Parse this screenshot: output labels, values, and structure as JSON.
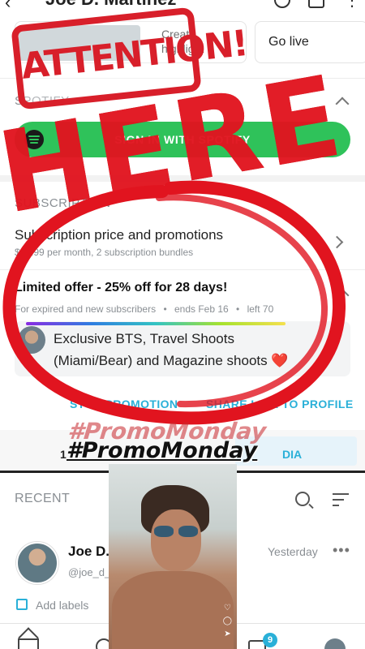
{
  "header": {
    "title": "Joe D. Martinez",
    "back_icon": "back-arrow-icon",
    "actions": [
      "gear-icon",
      "square-icon",
      "more-vertical-icon"
    ]
  },
  "tiles": {
    "create_highlight": "Create\nhighlight",
    "go_live": "Go live"
  },
  "spotify": {
    "section_label": "SPOTIFY",
    "button_label": "SIGN IN WITH SPOTIFY",
    "icon": "spotify-icon",
    "color": "#2fc25a"
  },
  "subscription": {
    "section_label": "SUBSCRIPTION",
    "price_title": "Subscription price and promotions",
    "price_meta": "$14.99 per month, 2 subscription bundles"
  },
  "offer": {
    "title": "Limited offer - 25% off for 28 days!",
    "audience": "For expired and new subscribers",
    "ends": "ends Feb 16",
    "left": "left 70",
    "message": "Exclusive BTS, Travel Shoots (Miami/Bear) and Magazine shoots",
    "heart": "❤️",
    "stop_label": "STOP PROMOTION",
    "share_label": "SHARE LINK TO PROFILE"
  },
  "tabs": {
    "left_label": "1",
    "right_label": "DIA"
  },
  "recent": {
    "label": "RECENT"
  },
  "chat": {
    "name": "Joe D.",
    "handle": "@joe_d_",
    "time": "Yesterday",
    "more": "•••",
    "add_labels": "Add labels"
  },
  "nav": {
    "badge": "9",
    "accent": "#2ab0d8"
  },
  "overlay": {
    "stamp_text": "ATTENTION!",
    "big_text": "HERE",
    "hashtag": "#PromoMonday",
    "ghost_hashtag": "#PromoMonday",
    "accent": "#e1141f"
  }
}
